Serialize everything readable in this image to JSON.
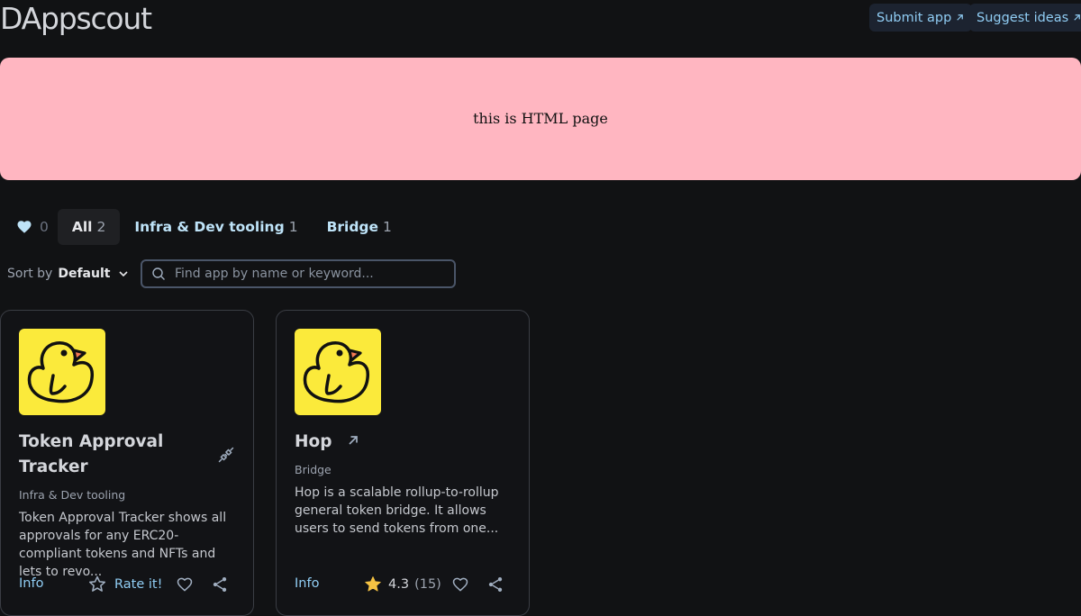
{
  "header": {
    "title": "DAppscout",
    "submit_label": "Submit app",
    "suggest_label": "Suggest ideas"
  },
  "banner": {
    "text": "this is HTML page"
  },
  "filters": {
    "favorites_count": "0",
    "tabs": [
      {
        "label": "All",
        "count": "2"
      },
      {
        "label": "Infra & Dev tooling",
        "count": "1"
      },
      {
        "label": "Bridge",
        "count": "1"
      }
    ]
  },
  "sort": {
    "prefix": "Sort by",
    "value": "Default"
  },
  "search": {
    "placeholder": "Find app by name or keyword..."
  },
  "apps": [
    {
      "name": "Token Approval Tracker",
      "category": "Infra & Dev tooling",
      "description": "Token Approval Tracker shows all approvals for any ERC20-compliant tokens and NFTs and lets to revo...",
      "info_label": "Info",
      "rate_label": "Rate it!",
      "status_icon": "disconnected-plug-icon"
    },
    {
      "name": "Hop",
      "category": "Bridge",
      "description": "Hop is a scalable rollup-to-rollup general token bridge. It allows users to send tokens from one...",
      "info_label": "Info",
      "rating": "4.3",
      "rating_count": "(15)"
    }
  ],
  "colors": {
    "background": "#111214",
    "accent": "#90cdf4",
    "banner": "#ffb6c1",
    "logo_bg": "#fbea3b",
    "star": "#f6c343"
  }
}
